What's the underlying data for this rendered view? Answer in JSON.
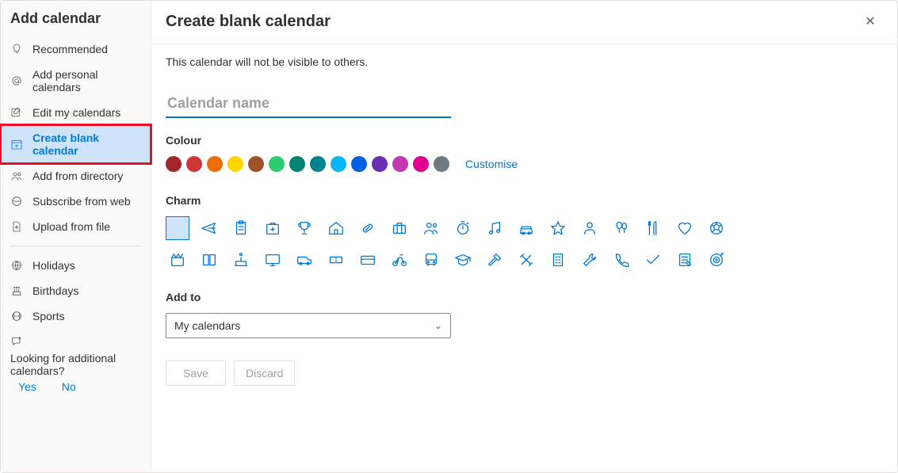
{
  "sidebar": {
    "title": "Add calendar",
    "items": [
      {
        "label": "Recommended",
        "icon": "lightbulb"
      },
      {
        "label": "Add personal calendars",
        "icon": "at"
      },
      {
        "label": "Edit my calendars",
        "icon": "edit"
      },
      {
        "label": "Create blank calendar",
        "icon": "calendar-plus",
        "selected": true
      },
      {
        "label": "Add from directory",
        "icon": "people"
      },
      {
        "label": "Subscribe from web",
        "icon": "globe-minus"
      },
      {
        "label": "Upload from file",
        "icon": "upload"
      }
    ],
    "secondary": [
      {
        "label": "Holidays",
        "icon": "globe"
      },
      {
        "label": "Birthdays",
        "icon": "cake"
      },
      {
        "label": "Sports",
        "icon": "ball"
      }
    ],
    "footer": {
      "text1": "Looking for additional",
      "text2": "calendars?",
      "yes": "Yes",
      "no": "No"
    }
  },
  "main": {
    "title": "Create blank calendar",
    "helper": "This calendar will not be visible to others.",
    "name_placeholder": "Calendar name",
    "colour_label": "Colour",
    "customise": "Customise",
    "colours": [
      "#a4262c",
      "#d13438",
      "#da3b01",
      "#ffb900",
      "#986f0b",
      "#0b6a0b",
      "#038387",
      "#005b70",
      "#0078d4",
      "#4f6bed",
      "#5c2e91",
      "#b4009e",
      "#c30052",
      "#69797e"
    ],
    "colours_alt": [
      "#a4262c",
      "#d13438",
      "#e8661b",
      "#ffd335",
      "#a35d1a",
      "#2ecc71",
      "#008272",
      "#00838f",
      "#00b7ff",
      "#0062e0",
      "#6b2fb3",
      "#c239b3",
      "#e3008c",
      "#6e7a7f"
    ],
    "charm_label": "Charm",
    "addto_label": "Add to",
    "addto_value": "My calendars",
    "save": "Save",
    "discard": "Discard"
  }
}
